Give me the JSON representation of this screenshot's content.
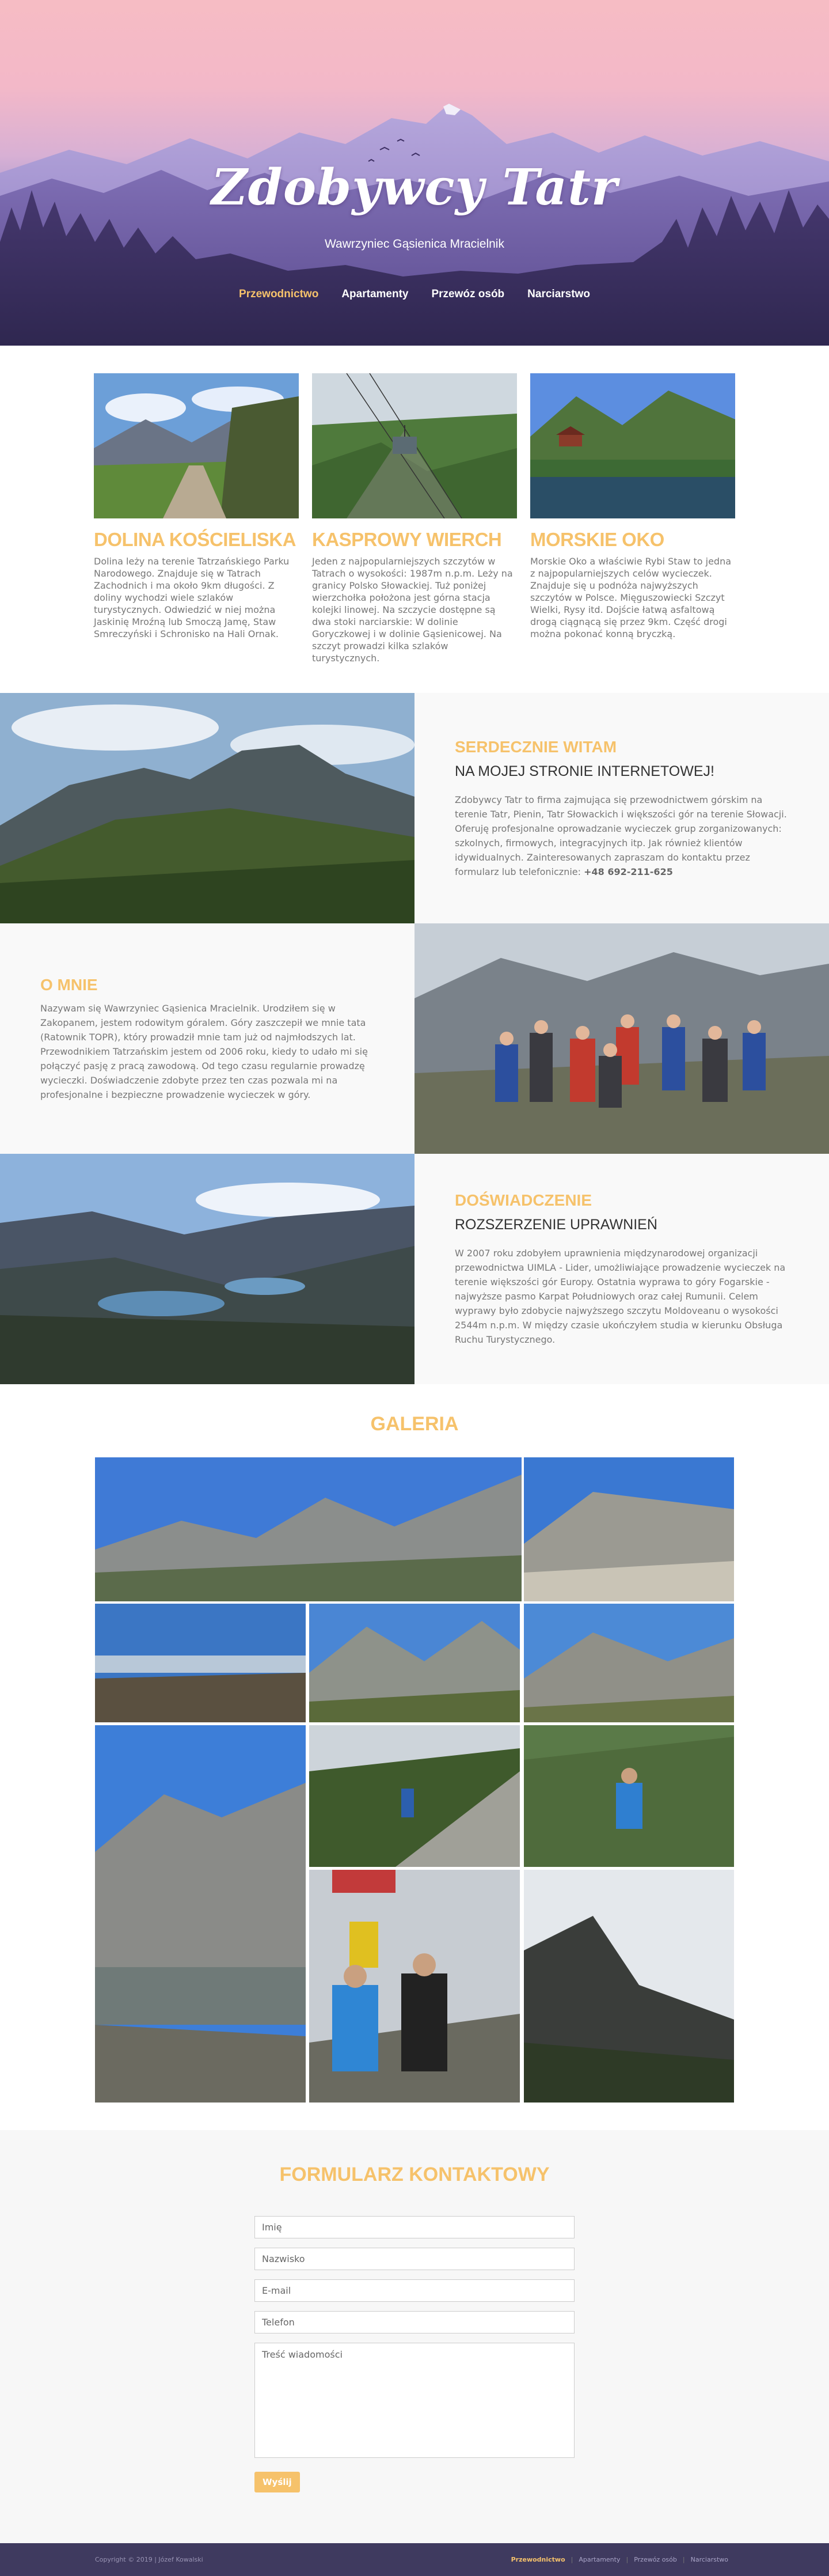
{
  "hero": {
    "title": "Zdobywcy Tatr",
    "subtitle": "Wawrzyniec Gąsienica Mracielnik",
    "nav": [
      "Przewodnictwo",
      "Apartamenty",
      "Przewóz osób",
      "Narciarstwo"
    ]
  },
  "attractions": [
    {
      "title": "DOLINA KOŚCIELISKA",
      "text": "Dolina leży na terenie Tatrzańskiego Parku Narodowego. Znajduje się w Tatrach Zachodnich i ma około 9km długości. Z doliny wychodzi wiele szlaków turystycznych. Odwiedzić w niej można Jaskinię Mroźną lub Smoczą Jamę, Staw Smreczyński i Schronisko na Hali Ornak."
    },
    {
      "title": "KASPROWY WIERCH",
      "text": "Jeden z najpopularniejszych szczytów w Tatrach o wysokości: 1987m n.p.m. Leży na granicy Polsko Słowackiej. Tuż poniżej wierzchołka położona jest górna stacja kolejki linowej. Na szczycie dostępne są dwa stoki narciarskie: W dolinie Goryczkowej i w dolinie Gąsienicowej. Na szczyt prowadzi kilka szlaków turystycznych."
    },
    {
      "title": "MORSKIE OKO",
      "text": "Morskie Oko a właściwie Rybi Staw to jedna z najpopularniejszych celów wycieczek. Znajduje się u podnóża najwyższych szczytów w Polsce. Mięguszowiecki Szczyt Wielki, Rysy itd. Dojście łatwą asfaltową drogą ciągnącą się przez 9km. Część drogi można pokonać konną bryczką."
    }
  ],
  "welcome": {
    "title": "SERDECZNIE WITAM",
    "subtitle": "NA MOJEJ STRONIE INTERNETOWEJ!",
    "text": "Zdobywcy Tatr to firma zajmująca się przewodnictwem górskim na terenie Tatr, Pienin, Tatr Słowackich i większości gór na terenie Słowacji. Oferuję profesjonalne oprowadzanie wycieczek grup zorganizowanych: szkolnych, firmowych, integracyjnych itp. Jak również klientów idywidualnych. Zainteresowanych zapraszam do kontaktu przez formularz lub telefonicznie:",
    "phone": "+48 692-211-625"
  },
  "about": {
    "title": "O MNIE",
    "text": "Nazywam się Wawrzyniec Gąsienica Mracielnik. Urodziłem się w Zakopanem, jestem rodowitym góralem. Góry zaszczepił we mnie tata (Ratownik TOPR), który prowadził mnie tam już od najmłodszych lat. Przewodnikiem Tatrzańskim jestem od 2006 roku, kiedy to udało mi się połączyć pasję z pracą zawodową. Od tego czasu regularnie prowadzę wycieczki. Doświadczenie zdobyte przez ten czas pozwala mi na profesjonalne i bezpieczne prowadzenie wycieczek w góry."
  },
  "experience": {
    "title": "DOŚWIADCZENIE",
    "subtitle": "ROZSZERZENIE UPRAWNIEŃ",
    "text": "W 2007 roku zdobyłem uprawnienia międzynarodowej organizacji przewodnictwa UIMLA - Lider, umożliwiające prowadzenie wycieczek na terenie większości gór Europy. Ostatnia wyprawa to góry Fogarskie - najwyższe pasmo Karpat Południowych oraz całej Rumunii. Celem wyprawy było zdobycie najwyższego szczytu Moldoveanu o wysokości 2544m n.p.m. W między czasie ukończyłem studia w kierunku Obsługa Ruchu Turystycznego."
  },
  "gallery": {
    "title": "GALERIA"
  },
  "contact": {
    "title": "FORMULARZ KONTAKTOWY",
    "fields": [
      "Imię",
      "Nazwisko",
      "E-mail",
      "Telefon"
    ],
    "message_placeholder": "Treść wiadomości",
    "submit": "Wyślij"
  },
  "footer": {
    "copyright": "Copyright © 2019 | Józef Kowalski",
    "nav": [
      "Przewodnictwo",
      "Apartamenty",
      "Przewóz osób",
      "Narciarstwo"
    ]
  }
}
